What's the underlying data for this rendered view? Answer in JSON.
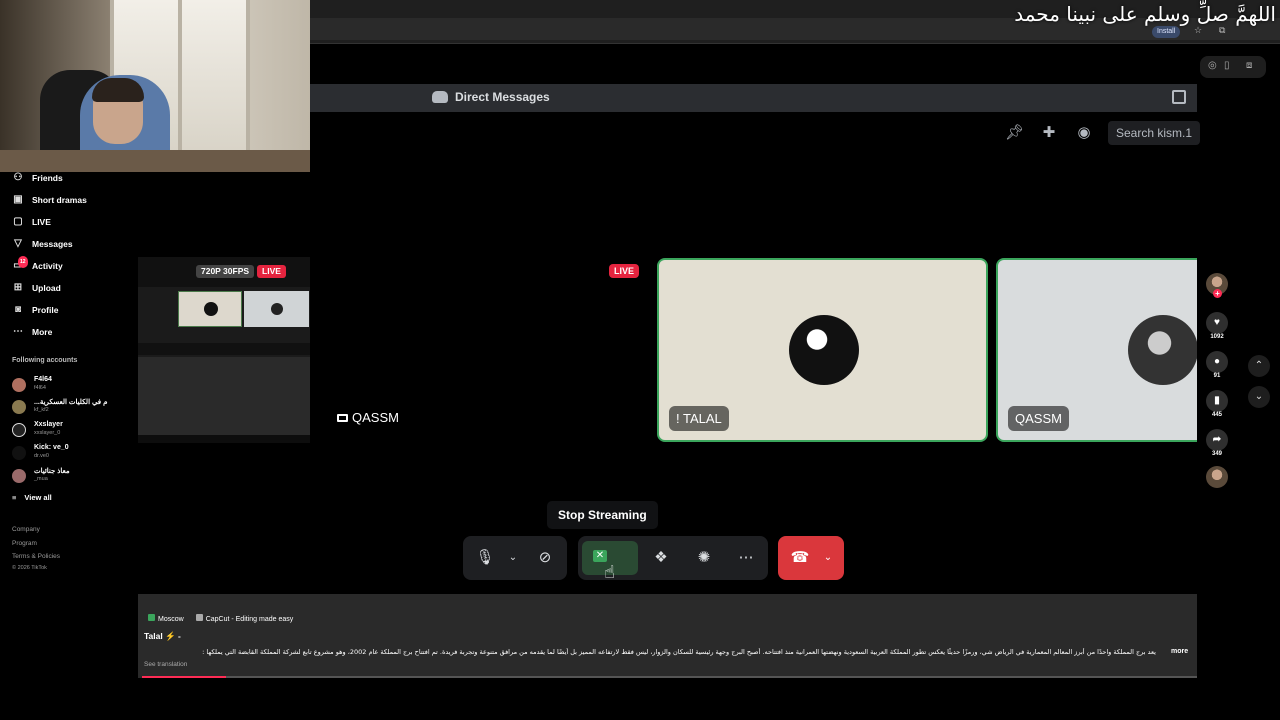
{
  "overlay_title": "اللهمَّ صلِّ وسلم على نبينا محمد",
  "browser": {
    "install_label": "Install"
  },
  "discord": {
    "header_title": "Direct Messages",
    "search_placeholder": "Search kism.1",
    "live_badge": "LIVE",
    "screen_share_label": "QASSM",
    "participants": [
      {
        "name": "! TALAL"
      },
      {
        "name": "QASSM"
      }
    ],
    "tooltip": "Stop Streaming",
    "controls": {
      "mic": "microphone-icon",
      "camera": "camera-off-icon",
      "stream": "screen-share-icon",
      "activities": "activities-icon",
      "soundboard": "soundboard-icon",
      "more": "more-icon",
      "hangup": "hang-up-icon"
    }
  },
  "stream_preview": {
    "quality": "720P 30FPS",
    "live": "LIVE"
  },
  "tiktok": {
    "nav": [
      {
        "label": "Friends",
        "icon": "friends-icon"
      },
      {
        "label": "Short dramas",
        "icon": "drama-icon"
      },
      {
        "label": "LIVE",
        "icon": "live-icon"
      },
      {
        "label": "Messages",
        "icon": "messages-icon"
      },
      {
        "label": "Activity",
        "icon": "activity-icon",
        "badge": "12"
      },
      {
        "label": "Upload",
        "icon": "upload-icon"
      },
      {
        "label": "Profile",
        "icon": "profile-icon"
      },
      {
        "label": "More",
        "icon": "more-icon"
      }
    ],
    "following_heading": "Following accounts",
    "accounts": [
      {
        "name": "F4l64",
        "handle": "f4l64"
      },
      {
        "name": "...م في الكليات العسكرية",
        "handle": "kf_kf2"
      },
      {
        "name": "Xxslayer",
        "handle": "xxslayer_0"
      },
      {
        "name": "Kick: ve_0",
        "handle": "dr.ve0"
      },
      {
        "name": "معاذ جنائيات",
        "handle": "_mua"
      }
    ],
    "view_all": "View all",
    "footer": [
      "Company",
      "Program",
      "Terms & Policies",
      "© 2026 TikTok"
    ],
    "post": {
      "tag1": "Moscow",
      "tag2": "CapCut - Editing made easy",
      "author": "Talal ⚡ -",
      "caption": "يعد برج المملكة واحدًا من أبرز المعالم المعمارية في الرياض شي، ورمزًا حديثًا يعكس تطور المملكة العربية السعودية ونهضتها العمرانية منذ افتتاحه. أصبح البرج وجهة رئيسية للسكان والزوار، ليس فقط لارتفاعه المميز بل أيضًا لما يقدمه من مرافق متنوعة وتجربة فريدة. تم افتتاح برج المملكة عام 2002، وهو مشروع تابع لشركة المملكة القابضة التي يملكها :",
      "more_label": "more",
      "see_translation": "See translation",
      "progress": 0.08
    },
    "rail": {
      "likes": "1092",
      "comments": "91",
      "saves": "445",
      "shares": "349"
    }
  }
}
